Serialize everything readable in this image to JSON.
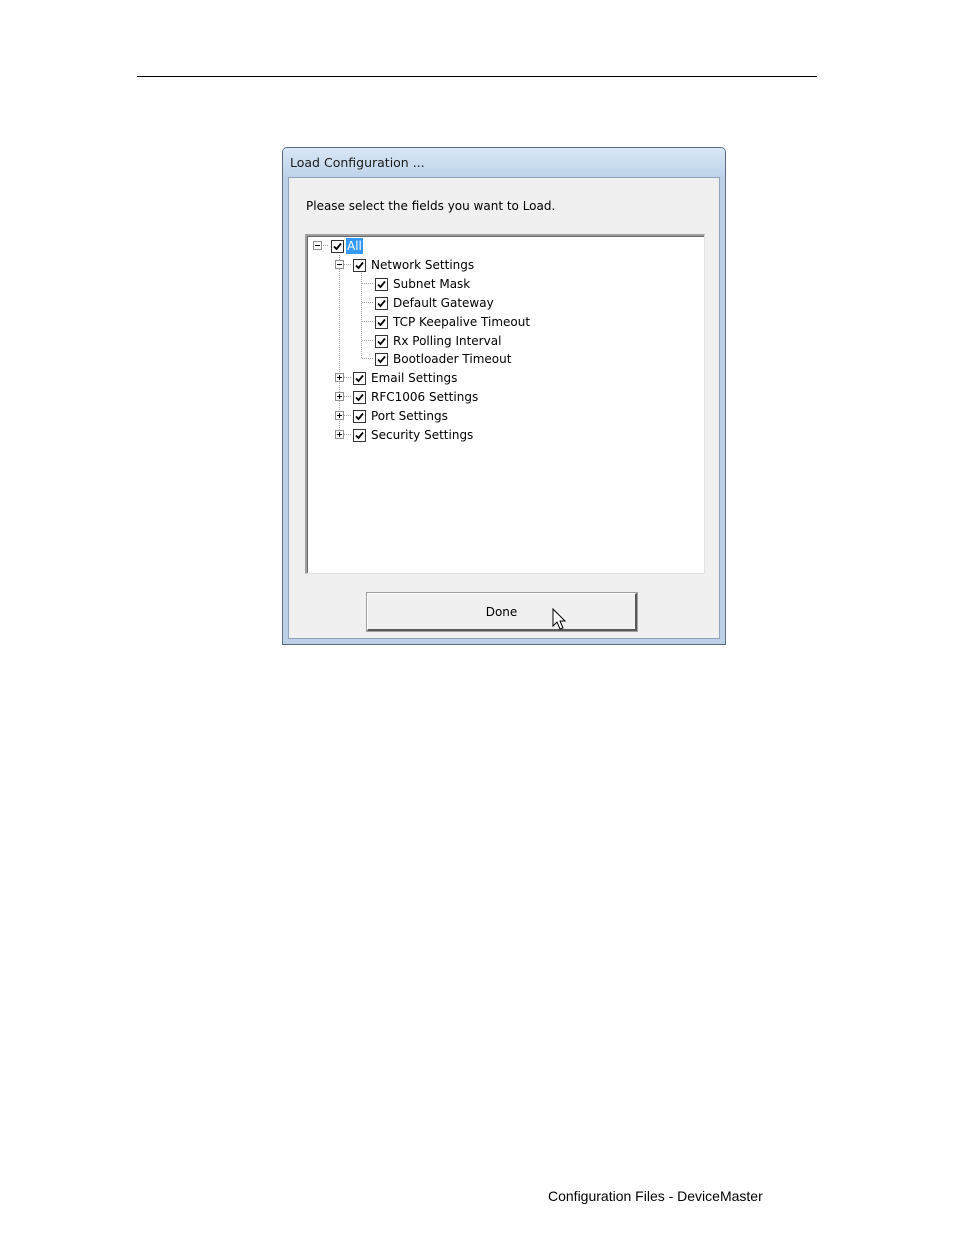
{
  "dialog": {
    "title": "Load Configuration ...",
    "prompt": "Please select the fields you want to Load.",
    "done_label": "Done",
    "tree": {
      "root": {
        "label": "All",
        "checked": true,
        "expanded": true,
        "selected": true
      },
      "network": {
        "label": "Network Settings",
        "checked": true,
        "expanded": true,
        "children": [
          {
            "label": "Subnet Mask",
            "checked": true
          },
          {
            "label": "Default Gateway",
            "checked": true
          },
          {
            "label": "TCP Keepalive Timeout",
            "checked": true
          },
          {
            "label": "Rx Polling Interval",
            "checked": true
          },
          {
            "label": "Bootloader Timeout",
            "checked": true
          }
        ]
      },
      "collapsed": [
        {
          "label": "Email Settings",
          "checked": true,
          "expanded": false
        },
        {
          "label": "RFC1006 Settings",
          "checked": true,
          "expanded": false
        },
        {
          "label": "Port Settings",
          "checked": true,
          "expanded": false
        },
        {
          "label": "Security Settings",
          "checked": true,
          "expanded": false
        }
      ]
    }
  },
  "footer": {
    "text": "Configuration Files - DeviceMaster"
  },
  "colors": {
    "selection": "#3399ff",
    "titlebar": "#bed3ea"
  }
}
